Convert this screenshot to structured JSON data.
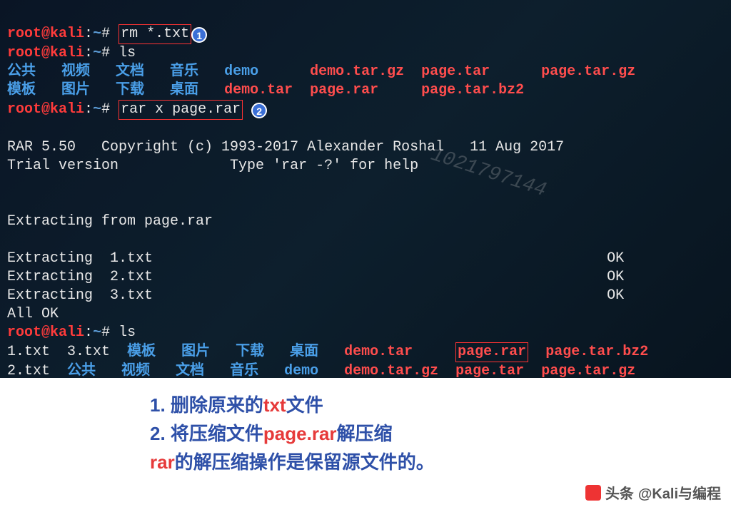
{
  "prompt": {
    "user": "root",
    "host": "kali",
    "path": "~",
    "symbol": "#"
  },
  "cmd1": "rm *.txt",
  "cmd2": "ls",
  "cmd3": "rar x page.rar",
  "cmd4": "ls",
  "marker1": "1",
  "marker2": "2",
  "ls1": {
    "row1": {
      "c1": "公共",
      "c2": "视频",
      "c3": "文档",
      "c4": "音乐",
      "c5": "demo",
      "c6": "demo.tar.gz",
      "c7": "page.tar",
      "c8": "page.tar.gz"
    },
    "row2": {
      "c1": "模板",
      "c2": "图片",
      "c3": "下载",
      "c4": "桌面",
      "c5": "demo.tar",
      "c6": "page.rar",
      "c7": "page.tar.bz2"
    }
  },
  "rar": {
    "banner1": "RAR 5.50   Copyright (c) 1993-2017 Alexander Roshal   11 Aug 2017",
    "banner2": "Trial version             Type 'rar -?' for help",
    "head": "Extracting from page.rar",
    "e1": {
      "l": "Extracting  1.txt",
      "r": "OK"
    },
    "e2": {
      "l": "Extracting  2.txt",
      "r": "OK"
    },
    "e3": {
      "l": "Extracting  3.txt",
      "r": "OK"
    },
    "done": "All OK"
  },
  "ls2": {
    "row1": {
      "c1": "1.txt",
      "c2": "3.txt",
      "c3": "模板",
      "c4": "图片",
      "c5": "下载",
      "c6": "桌面",
      "c7": "demo.tar",
      "c8": "page.rar",
      "c9": "page.tar.bz2"
    },
    "row2": {
      "c1": "2.txt",
      "c2": "公共",
      "c3": "视频",
      "c4": "文档",
      "c5": "音乐",
      "c6": "demo",
      "c7": "demo.tar.gz",
      "c8": "page.tar",
      "c9": "page.tar.gz"
    }
  },
  "watermark": "1021797144",
  "caption": {
    "l1a": "1. 删除原来的",
    "l1b": "txt",
    "l1c": "文件",
    "l2a": "2. 将压缩文件",
    "l2b": "page.rar",
    "l2c": "解压缩",
    "l3a": "rar",
    "l3b": "的解压缩操作是保留源文件的。"
  },
  "footer": {
    "prefix": "头条",
    "name": "@Kali与编程"
  }
}
